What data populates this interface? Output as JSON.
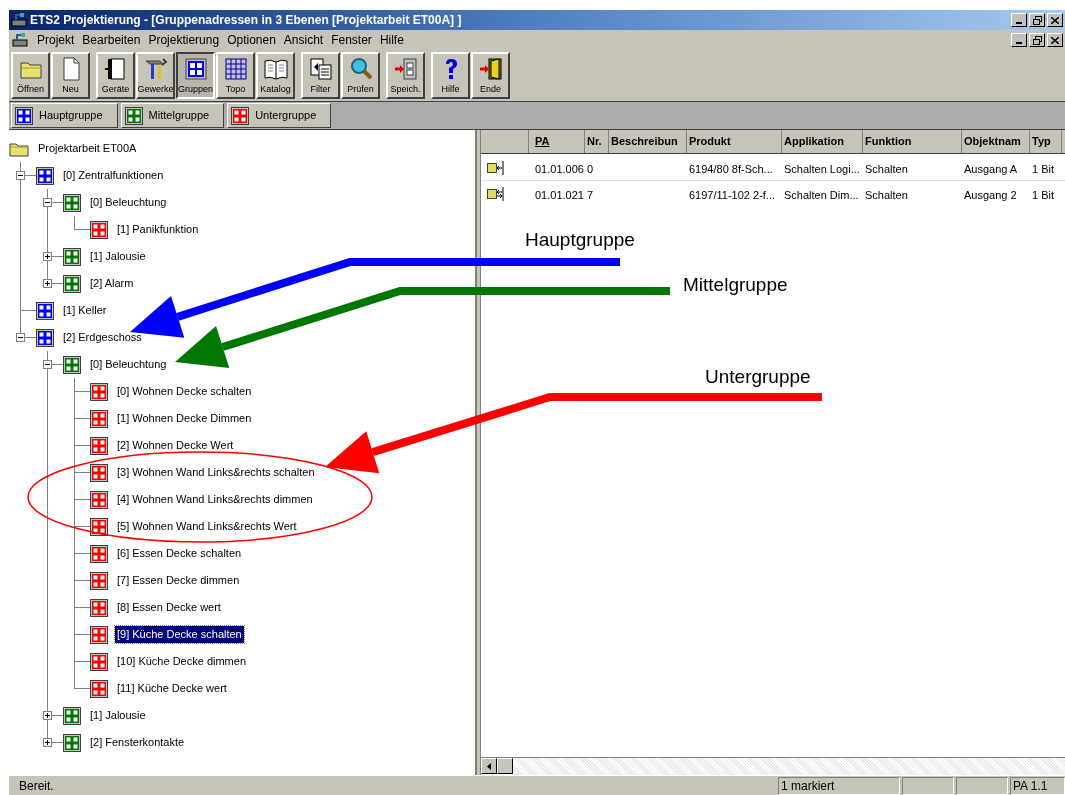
{
  "window": {
    "title": "ETS2 Projektierung - [Gruppenadressen in 3 Ebenen [Projektarbeit ET00A] ]"
  },
  "menu": [
    "Projekt",
    "Bearbeiten",
    "Projektierung",
    "Optionen",
    "Ansicht",
    "Fenster",
    "Hilfe"
  ],
  "toolbar": [
    [
      {
        "label": "Öffnen",
        "kind": "open",
        "selected": false
      },
      {
        "label": "Neu",
        "kind": "new",
        "selected": false
      }
    ],
    [
      {
        "label": "Geräte",
        "kind": "devices",
        "selected": false
      },
      {
        "label": "Gewerke",
        "kind": "trades",
        "selected": false
      },
      {
        "label": "Gruppen",
        "kind": "groups",
        "selected": true
      },
      {
        "label": "Topo",
        "kind": "topo",
        "selected": false
      },
      {
        "label": "Katalog",
        "kind": "catalog",
        "selected": false
      }
    ],
    [
      {
        "label": "Filter",
        "kind": "filter",
        "selected": false
      },
      {
        "label": "Prüfen",
        "kind": "check",
        "selected": false
      }
    ],
    [
      {
        "label": "Speich.",
        "kind": "save",
        "selected": false
      }
    ],
    [
      {
        "label": "Hilfe",
        "kind": "help",
        "selected": false
      },
      {
        "label": "Ende",
        "kind": "exit",
        "selected": false
      }
    ]
  ],
  "group_buttons": [
    {
      "label": "Hauptgruppe",
      "kind": "main"
    },
    {
      "label": "Mittelgruppe",
      "kind": "middle"
    },
    {
      "label": "Untergruppe",
      "kind": "sub"
    }
  ],
  "tree": {
    "label": "Projektarbeit ET00A",
    "kind": "project",
    "children": [
      {
        "label": "[0] Zentralfunktionen",
        "kind": "main",
        "expanded": true,
        "selected": false,
        "children": [
          {
            "label": "[0] Beleuchtung",
            "kind": "middle",
            "expanded": true,
            "selected": false,
            "children": [
              {
                "label": "[1] Panikfunktion",
                "kind": "sub",
                "selected": false
              }
            ]
          },
          {
            "label": "[1] Jalousie",
            "kind": "middle",
            "expanded": false,
            "selected": false
          },
          {
            "label": "[2] Alarm",
            "kind": "middle",
            "expanded": false,
            "selected": false
          }
        ]
      },
      {
        "label": "[1] Keller",
        "kind": "main",
        "selected": false
      },
      {
        "label": "[2] Erdgeschoss",
        "kind": "main",
        "expanded": true,
        "selected": false,
        "children": [
          {
            "label": "[0] Beleuchtung",
            "kind": "middle",
            "expanded": true,
            "selected": false,
            "children": [
              {
                "label": "[0] Wohnen Decke schalten",
                "kind": "sub",
                "selected": false
              },
              {
                "label": "[1] Wohnen Decke Dimmen",
                "kind": "sub",
                "selected": false
              },
              {
                "label": "[2] Wohnen Decke Wert",
                "kind": "sub",
                "selected": false
              },
              {
                "label": "[3] Wohnen Wand Links&rechts schalten",
                "kind": "sub",
                "selected": false
              },
              {
                "label": "[4] Wohnen Wand Links&rechts dimmen",
                "kind": "sub",
                "selected": false
              },
              {
                "label": "[5] Wohnen Wand Links&rechts Wert",
                "kind": "sub",
                "selected": false
              },
              {
                "label": "[6] Essen Decke schalten",
                "kind": "sub",
                "selected": false
              },
              {
                "label": "[7] Essen Decke dimmen",
                "kind": "sub",
                "selected": false
              },
              {
                "label": "[8] Essen Decke wert",
                "kind": "sub",
                "selected": false
              },
              {
                "label": "[9] Küche Decke schalten",
                "kind": "sub",
                "selected": true
              },
              {
                "label": "[10] Küche Decke dimmen",
                "kind": "sub",
                "selected": false
              },
              {
                "label": "[11] Küche Decke wert",
                "kind": "sub",
                "selected": false
              }
            ]
          },
          {
            "label": "[1] Jalousie",
            "kind": "middle",
            "expanded": false,
            "selected": false
          },
          {
            "label": "[2] Fensterkontakte",
            "kind": "middle",
            "expanded": false,
            "selected": false
          }
        ]
      }
    ]
  },
  "table": {
    "columns": [
      "PA",
      "Nr.",
      "Beschreibun",
      "Produkt",
      "Applikation",
      "Funktion",
      "Objektnam",
      "Typ"
    ],
    "rows": [
      {
        "kind": "in",
        "cells": [
          "01.01.006",
          "0",
          "",
          "6194/80 8f-Sch...",
          "Schalten Logi...",
          "Schalten",
          "Ausgang A",
          "1 Bit"
        ]
      },
      {
        "kind": "inout",
        "cells": [
          "01.01.021",
          "7",
          "",
          "6197/11-102 2-f...",
          "Schalten Dim...",
          "Schalten",
          "Ausgang 2",
          "1 Bit"
        ]
      }
    ]
  },
  "annotations": [
    {
      "label": "Hauptgruppe",
      "color": "#0000ff"
    },
    {
      "label": "Mittelgruppe",
      "color": "#007700"
    },
    {
      "label": "Untergruppe",
      "color": "#ff0000"
    }
  ],
  "status_bar": {
    "message": "Bereit.",
    "selection": "1 markiert",
    "address": "PA 1.1"
  }
}
